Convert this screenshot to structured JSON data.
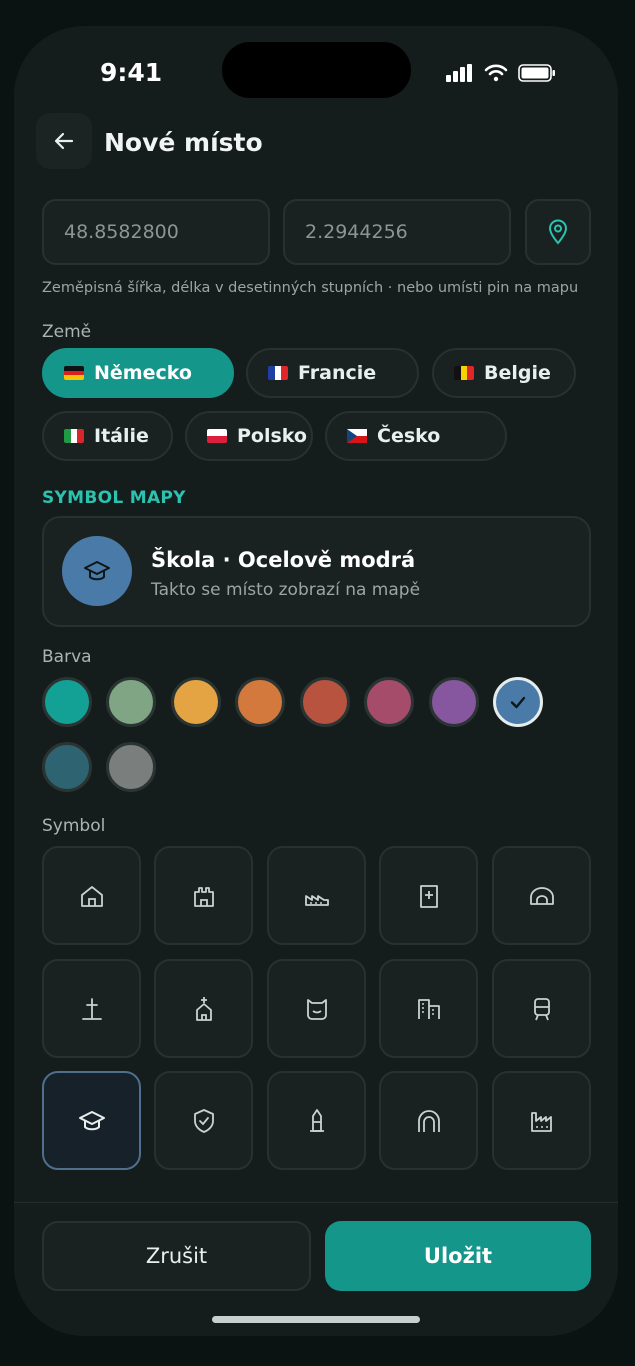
{
  "status": {
    "time": "9:41"
  },
  "header": {
    "title": "Nové místo"
  },
  "coords": {
    "lat": "48.8582800",
    "lon": "2.2944256",
    "hint": "Zeměpisná šířka, délka v desetinných stupních · nebo umísti pin na mapu"
  },
  "country": {
    "label": "Země",
    "chips": [
      {
        "label": "Německo",
        "selected": true
      },
      {
        "label": "Francie",
        "selected": false
      },
      {
        "label": "Belgie",
        "selected": false
      },
      {
        "label": "Itálie",
        "selected": false
      },
      {
        "label": "Polsko",
        "selected": false
      },
      {
        "label": "Česko",
        "selected": false
      }
    ]
  },
  "symbol_section": {
    "title": "SYMBOL MAPY"
  },
  "preview": {
    "title": "Škola · Ocelově modrá",
    "subtitle": "Takto se místo zobrazí na mapě",
    "color": "#4a7ba8",
    "icon": "graduation-cap-icon"
  },
  "color_picker": {
    "label": "Barva",
    "swatches": [
      "#14a195",
      "#7fa584",
      "#e4a443",
      "#d4793d",
      "#b85340",
      "#a64c6b",
      "#86579f",
      "#4a7ba8",
      "#2e6471",
      "#7a7e7d"
    ],
    "selected_index": 7
  },
  "symbol_picker": {
    "label": "Symbol",
    "icons": [
      "house-icon",
      "castle-icon",
      "factory-icon",
      "hospital-icon",
      "tunnel-icon",
      "grave-icon",
      "church-icon",
      "face-icon",
      "buildings-icon",
      "tram-icon",
      "graduation-cap-icon",
      "shield-check-icon",
      "tower-icon",
      "arch-icon",
      "industry-icon"
    ],
    "selected_index": 10
  },
  "footer": {
    "cancel": "Zrušit",
    "save": "Uložit"
  },
  "colors": {
    "accent": "#15968a",
    "accent_text": "#2bc2b0"
  }
}
